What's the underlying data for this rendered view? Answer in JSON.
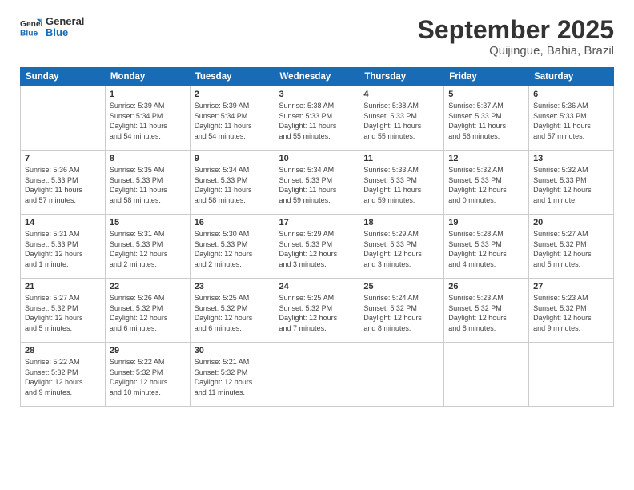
{
  "logo": {
    "line1": "General",
    "line2": "Blue"
  },
  "title": "September 2025",
  "location": "Quijingue, Bahia, Brazil",
  "days_of_week": [
    "Sunday",
    "Monday",
    "Tuesday",
    "Wednesday",
    "Thursday",
    "Friday",
    "Saturday"
  ],
  "weeks": [
    [
      {
        "day": "",
        "info": ""
      },
      {
        "day": "1",
        "info": "Sunrise: 5:39 AM\nSunset: 5:34 PM\nDaylight: 11 hours\nand 54 minutes."
      },
      {
        "day": "2",
        "info": "Sunrise: 5:39 AM\nSunset: 5:34 PM\nDaylight: 11 hours\nand 54 minutes."
      },
      {
        "day": "3",
        "info": "Sunrise: 5:38 AM\nSunset: 5:33 PM\nDaylight: 11 hours\nand 55 minutes."
      },
      {
        "day": "4",
        "info": "Sunrise: 5:38 AM\nSunset: 5:33 PM\nDaylight: 11 hours\nand 55 minutes."
      },
      {
        "day": "5",
        "info": "Sunrise: 5:37 AM\nSunset: 5:33 PM\nDaylight: 11 hours\nand 56 minutes."
      },
      {
        "day": "6",
        "info": "Sunrise: 5:36 AM\nSunset: 5:33 PM\nDaylight: 11 hours\nand 57 minutes."
      }
    ],
    [
      {
        "day": "7",
        "info": "Sunrise: 5:36 AM\nSunset: 5:33 PM\nDaylight: 11 hours\nand 57 minutes."
      },
      {
        "day": "8",
        "info": "Sunrise: 5:35 AM\nSunset: 5:33 PM\nDaylight: 11 hours\nand 58 minutes."
      },
      {
        "day": "9",
        "info": "Sunrise: 5:34 AM\nSunset: 5:33 PM\nDaylight: 11 hours\nand 58 minutes."
      },
      {
        "day": "10",
        "info": "Sunrise: 5:34 AM\nSunset: 5:33 PM\nDaylight: 11 hours\nand 59 minutes."
      },
      {
        "day": "11",
        "info": "Sunrise: 5:33 AM\nSunset: 5:33 PM\nDaylight: 11 hours\nand 59 minutes."
      },
      {
        "day": "12",
        "info": "Sunrise: 5:32 AM\nSunset: 5:33 PM\nDaylight: 12 hours\nand 0 minutes."
      },
      {
        "day": "13",
        "info": "Sunrise: 5:32 AM\nSunset: 5:33 PM\nDaylight: 12 hours\nand 1 minute."
      }
    ],
    [
      {
        "day": "14",
        "info": "Sunrise: 5:31 AM\nSunset: 5:33 PM\nDaylight: 12 hours\nand 1 minute."
      },
      {
        "day": "15",
        "info": "Sunrise: 5:31 AM\nSunset: 5:33 PM\nDaylight: 12 hours\nand 2 minutes."
      },
      {
        "day": "16",
        "info": "Sunrise: 5:30 AM\nSunset: 5:33 PM\nDaylight: 12 hours\nand 2 minutes."
      },
      {
        "day": "17",
        "info": "Sunrise: 5:29 AM\nSunset: 5:33 PM\nDaylight: 12 hours\nand 3 minutes."
      },
      {
        "day": "18",
        "info": "Sunrise: 5:29 AM\nSunset: 5:33 PM\nDaylight: 12 hours\nand 3 minutes."
      },
      {
        "day": "19",
        "info": "Sunrise: 5:28 AM\nSunset: 5:33 PM\nDaylight: 12 hours\nand 4 minutes."
      },
      {
        "day": "20",
        "info": "Sunrise: 5:27 AM\nSunset: 5:32 PM\nDaylight: 12 hours\nand 5 minutes."
      }
    ],
    [
      {
        "day": "21",
        "info": "Sunrise: 5:27 AM\nSunset: 5:32 PM\nDaylight: 12 hours\nand 5 minutes."
      },
      {
        "day": "22",
        "info": "Sunrise: 5:26 AM\nSunset: 5:32 PM\nDaylight: 12 hours\nand 6 minutes."
      },
      {
        "day": "23",
        "info": "Sunrise: 5:25 AM\nSunset: 5:32 PM\nDaylight: 12 hours\nand 6 minutes."
      },
      {
        "day": "24",
        "info": "Sunrise: 5:25 AM\nSunset: 5:32 PM\nDaylight: 12 hours\nand 7 minutes."
      },
      {
        "day": "25",
        "info": "Sunrise: 5:24 AM\nSunset: 5:32 PM\nDaylight: 12 hours\nand 8 minutes."
      },
      {
        "day": "26",
        "info": "Sunrise: 5:23 AM\nSunset: 5:32 PM\nDaylight: 12 hours\nand 8 minutes."
      },
      {
        "day": "27",
        "info": "Sunrise: 5:23 AM\nSunset: 5:32 PM\nDaylight: 12 hours\nand 9 minutes."
      }
    ],
    [
      {
        "day": "28",
        "info": "Sunrise: 5:22 AM\nSunset: 5:32 PM\nDaylight: 12 hours\nand 9 minutes."
      },
      {
        "day": "29",
        "info": "Sunrise: 5:22 AM\nSunset: 5:32 PM\nDaylight: 12 hours\nand 10 minutes."
      },
      {
        "day": "30",
        "info": "Sunrise: 5:21 AM\nSunset: 5:32 PM\nDaylight: 12 hours\nand 11 minutes."
      },
      {
        "day": "",
        "info": ""
      },
      {
        "day": "",
        "info": ""
      },
      {
        "day": "",
        "info": ""
      },
      {
        "day": "",
        "info": ""
      }
    ]
  ]
}
